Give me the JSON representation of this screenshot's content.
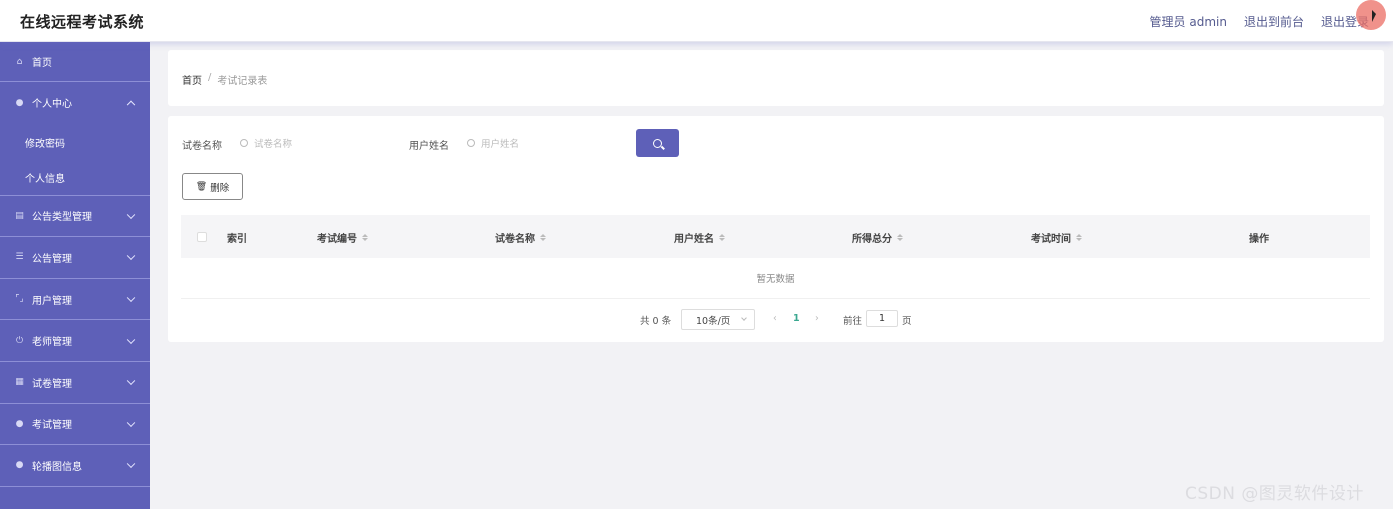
{
  "app": {
    "title": "在线远程考试系统"
  },
  "header": {
    "links": [
      "管理员 admin",
      "退出到前台",
      "退出登录"
    ]
  },
  "sidebar": {
    "items": [
      {
        "label": "首页",
        "icon": "home-icon"
      },
      {
        "label": "个人中心",
        "icon": "user-icon",
        "expanded": true,
        "children": [
          "修改密码",
          "个人信息"
        ]
      },
      {
        "label": "公告类型管理",
        "icon": "folder-icon"
      },
      {
        "label": "公告管理",
        "icon": "list-icon"
      },
      {
        "label": "用户管理",
        "icon": "frame-icon"
      },
      {
        "label": "老师管理",
        "icon": "power-icon"
      },
      {
        "label": "试卷管理",
        "icon": "document-icon"
      },
      {
        "label": "考试管理",
        "icon": "user-icon"
      },
      {
        "label": "轮播图信息",
        "icon": "user-icon"
      }
    ]
  },
  "breadcrumb": {
    "home": "首页",
    "separator": "/",
    "current": "考试记录表"
  },
  "search": {
    "paper_label": "试卷名称",
    "paper_placeholder": "试卷名称",
    "user_label": "用户姓名",
    "user_placeholder": "用户姓名"
  },
  "actions": {
    "delete_label": "删除"
  },
  "table": {
    "columns": [
      "索引",
      "考试编号",
      "试卷名称",
      "用户姓名",
      "所得总分",
      "考试时间",
      "操作"
    ],
    "empty_text": "暂无数据"
  },
  "pagination": {
    "total": "共 0 条",
    "page_size": "10条/页",
    "current_page": "1",
    "goto_label": "前往",
    "goto_value": "1",
    "page_unit": "页"
  },
  "watermark": "CSDN @图灵软件设计",
  "colors": {
    "accent": "#5e60b8",
    "page_active": "#3aa890"
  }
}
